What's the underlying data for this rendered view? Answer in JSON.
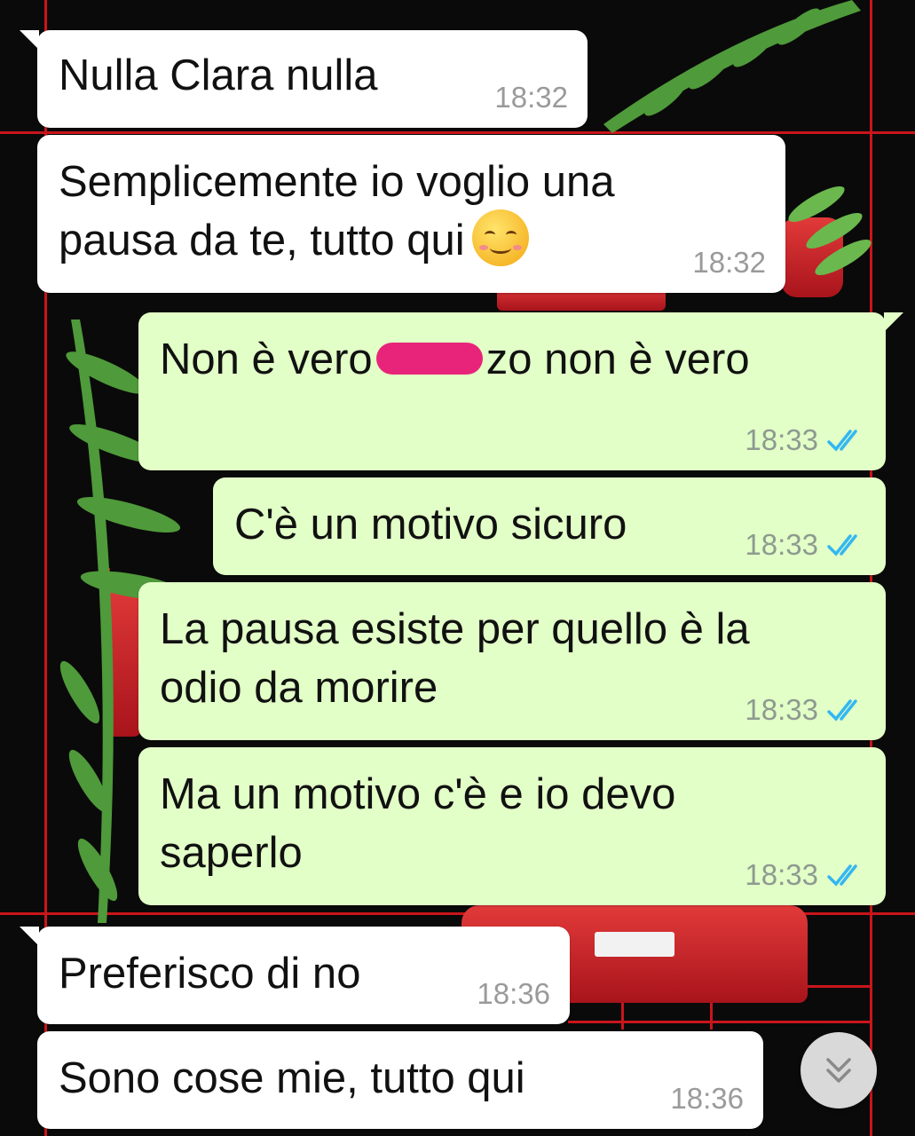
{
  "chat": {
    "messages": [
      {
        "direction": "in",
        "text": "Nulla Clara nulla",
        "time": "18:32"
      },
      {
        "direction": "in",
        "lines": [
          "Semplicemente io voglio una",
          "pausa da te, tutto qui"
        ],
        "emoji": "smiling-face-icon",
        "time": "18:32"
      },
      {
        "direction": "out",
        "text_before": "Non è vero",
        "text_after": "zo non è vero",
        "redaction": "pink-censor-mark",
        "time": "18:33",
        "status": "read"
      },
      {
        "direction": "out",
        "text": "C'è un motivo sicuro",
        "time": "18:33",
        "status": "read"
      },
      {
        "direction": "out",
        "lines": [
          "La pausa esiste per quello è la",
          "odio da morire"
        ],
        "time": "18:33",
        "status": "read"
      },
      {
        "direction": "out",
        "lines": [
          "Ma un motivo c'è e io devo",
          "saperlo"
        ],
        "time": "18:33",
        "status": "read"
      },
      {
        "direction": "in",
        "text": "Preferisco di no",
        "time": "18:36"
      },
      {
        "direction": "in",
        "text": "Sono cose mie, tutto qui",
        "time": "18:36"
      }
    ]
  },
  "scroll_button": {
    "icon": "double-chevron-down-icon"
  },
  "colors": {
    "incoming_bubble": "#ffffff",
    "outgoing_bubble": "#e2ffc7",
    "read_ticks": "#34b7f1",
    "time_text": "#8e9a90",
    "wallpaper_grid": "#c9151b",
    "censor": "#e8247a"
  }
}
